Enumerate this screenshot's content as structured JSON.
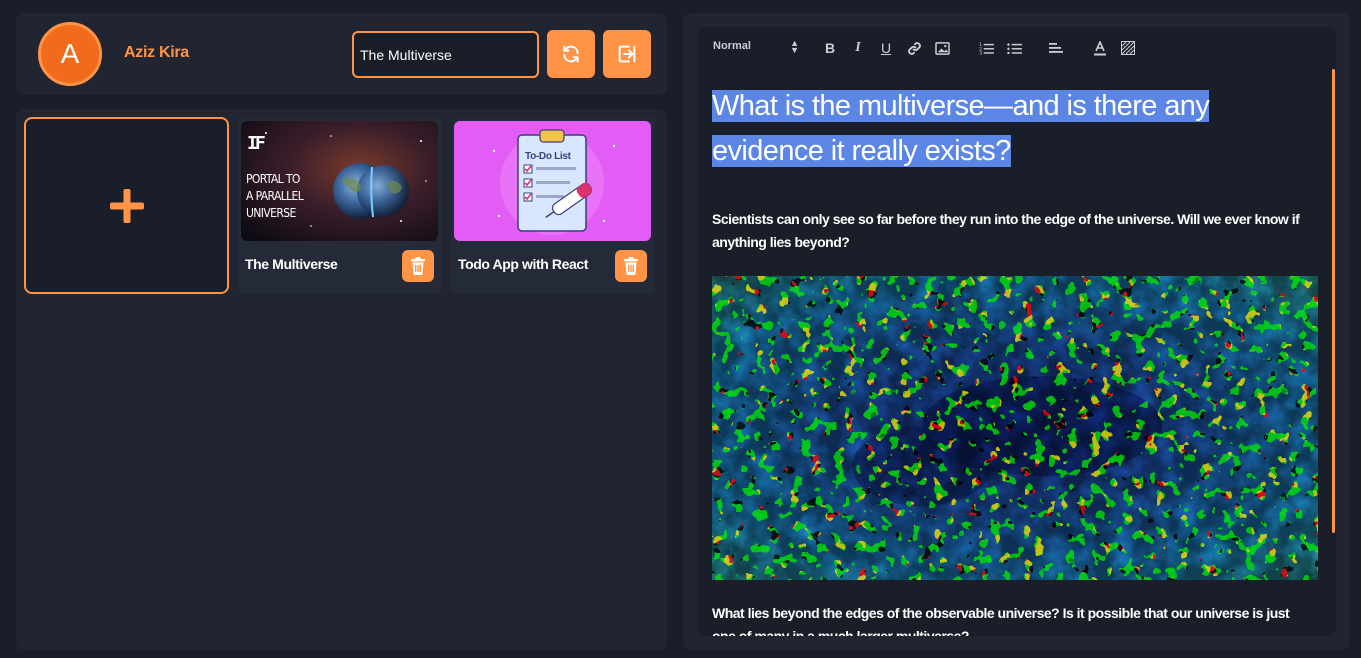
{
  "user": {
    "initial": "A",
    "name": "Aziz Kira"
  },
  "header": {
    "title_value": "The Multiverse",
    "refresh_icon": "refresh-icon",
    "logout_icon": "logout-icon"
  },
  "notes": [
    {
      "title": "The Multiverse",
      "thumb_lines": [
        "PORTAL TO",
        "A PARALLEL",
        "UNIVERSE"
      ],
      "thumb_logo": "IF"
    },
    {
      "title": "Todo App with React",
      "thumb_caption": "To-Do List"
    }
  ],
  "add_icon": "plus-icon",
  "editor": {
    "format": "Normal",
    "toolbar": [
      "bold-icon",
      "italic-icon",
      "underline-icon",
      "link-icon",
      "image-icon",
      "ordered-list-icon",
      "bullet-list-icon",
      "align-icon",
      "text-color-icon",
      "background-color-icon"
    ],
    "heading": "What is the multiverse—and is there any evidence it really exists?",
    "paragraph1": "Scientists can only see so far before they run into the edge of the universe. Will we ever know if anything lies beyond?",
    "paragraph2": "What lies beyond the edges of the observable universe? Is it possible that our universe is just one of many in a much larger multiverse?"
  },
  "colors": {
    "accent": "#ff9446",
    "bg": "#1a1e29",
    "panel": "#202531",
    "highlight": "#5b86e5"
  }
}
